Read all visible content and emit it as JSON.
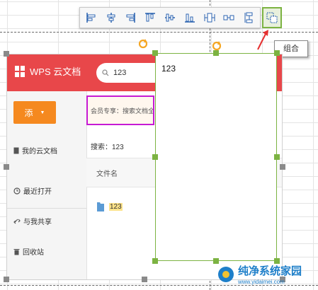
{
  "toolbar": {
    "tools": [
      {
        "icon": "align-left-icon"
      },
      {
        "icon": "align-center-horizontal-icon"
      },
      {
        "icon": "align-right-icon"
      },
      {
        "icon": "align-top-icon"
      },
      {
        "icon": "align-middle-vertical-icon"
      },
      {
        "icon": "align-bottom-icon"
      },
      {
        "icon": "distribute-horizontal-icon"
      },
      {
        "icon": "distribute-vertical-icon"
      },
      {
        "icon": "stack-icon"
      }
    ],
    "group_icon": "group-icon",
    "tooltip": "组合"
  },
  "app": {
    "logo_text": "WPS 云文档",
    "search_value": "123",
    "new_button": "添",
    "sidebar": {
      "my_docs": "我的云文档",
      "recent": "最近打开",
      "shared": "与我共享",
      "trash": "回收站"
    },
    "promo": "会员专享：搜索文档全文",
    "search_result": "搜索：123",
    "column_filename": "文件名",
    "file_name": "123",
    "colors": {
      "brand": "#e8474a",
      "new_button": "#f5891f",
      "selection": "#7cb342",
      "highlight": "#c61ad3"
    }
  },
  "textbox": {
    "text": "123"
  },
  "watermark": {
    "title": "纯净系统家园",
    "url": "www.yidaimei.com"
  }
}
